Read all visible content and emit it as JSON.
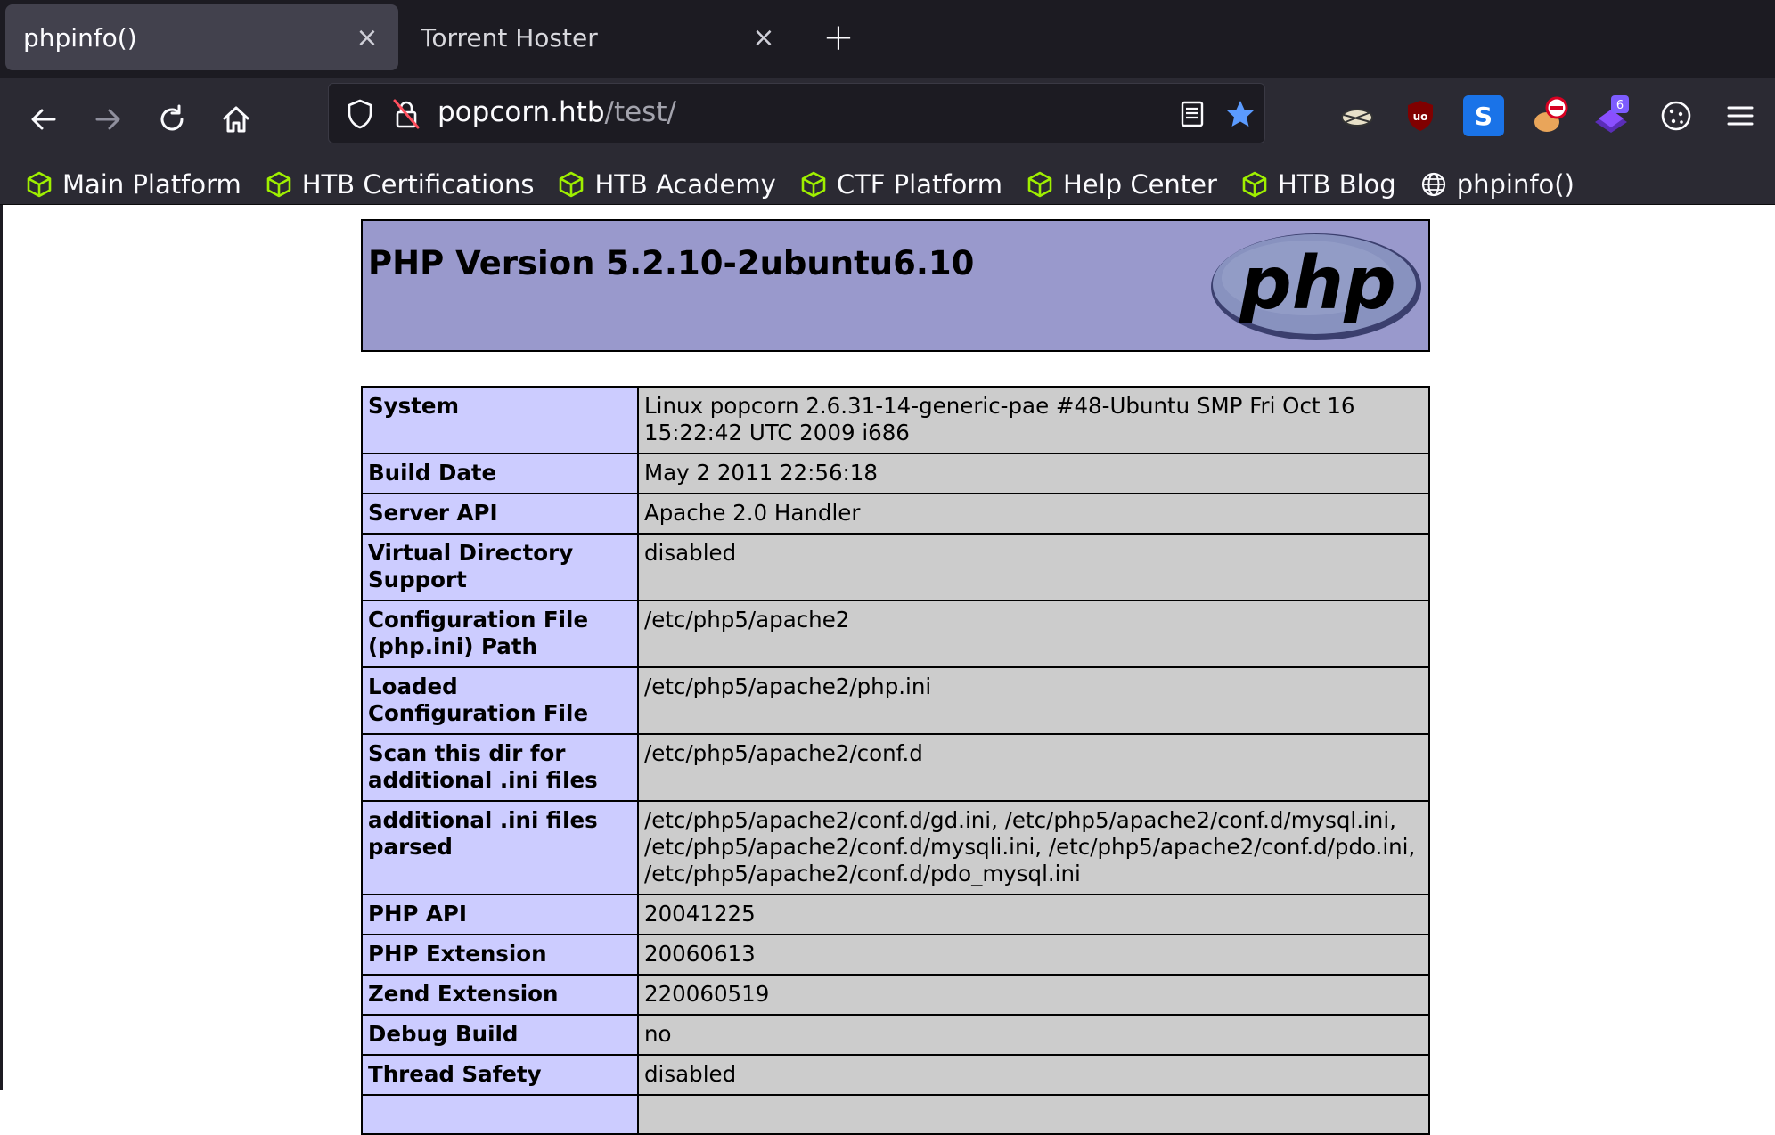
{
  "tabs": [
    {
      "title": "phpinfo()",
      "active": true
    },
    {
      "title": "Torrent Hoster",
      "active": false
    }
  ],
  "tab_close_glyph": "×",
  "new_tab_glyph": "+",
  "urlbar": {
    "host": "popcorn.htb",
    "path": "/test/"
  },
  "extensions": [
    "user-agent-switcher-icon",
    "ublock-origin-icon",
    "s-extension-icon",
    "blocker-extension-icon",
    "badge-extension-icon",
    "cookie-icon"
  ],
  "extension_badge": "6",
  "ublock_label": "uo",
  "s_label": "S",
  "bookmarks": [
    {
      "label": "Main Platform",
      "icon": "htb-cube-icon"
    },
    {
      "label": "HTB Certifications",
      "icon": "htb-cube-icon"
    },
    {
      "label": "HTB Academy",
      "icon": "htb-cube-icon"
    },
    {
      "label": "CTF Platform",
      "icon": "htb-cube-icon"
    },
    {
      "label": "Help Center",
      "icon": "htb-cube-icon"
    },
    {
      "label": "HTB Blog",
      "icon": "htb-cube-icon"
    },
    {
      "label": "phpinfo()",
      "icon": "globe-icon"
    }
  ],
  "header": {
    "title": "PHP Version 5.2.10-2ubuntu6.10",
    "logo_text": "php"
  },
  "info_rows": [
    {
      "key": "System",
      "value": "Linux popcorn 2.6.31-14-generic-pae #48-Ubuntu SMP Fri Oct 16 15:22:42 UTC 2009 i686"
    },
    {
      "key": "Build Date",
      "value": "May 2 2011 22:56:18"
    },
    {
      "key": "Server API",
      "value": "Apache 2.0 Handler"
    },
    {
      "key": "Virtual Directory Support",
      "value": "disabled"
    },
    {
      "key": "Configuration File (php.ini) Path",
      "value": "/etc/php5/apache2"
    },
    {
      "key": "Loaded Configuration File",
      "value": "/etc/php5/apache2/php.ini"
    },
    {
      "key": "Scan this dir for additional .ini files",
      "value": "/etc/php5/apache2/conf.d"
    },
    {
      "key": "additional .ini files parsed",
      "value": "/etc/php5/apache2/conf.d/gd.ini, /etc/php5/apache2/conf.d/mysql.ini, /etc/php5/apache2/conf.d/mysqli.ini, /etc/php5/apache2/conf.d/pdo.ini, /etc/php5/apache2/conf.d/pdo_mysql.ini"
    },
    {
      "key": "PHP API",
      "value": "20041225"
    },
    {
      "key": "PHP Extension",
      "value": "20060613"
    },
    {
      "key": "Zend Extension",
      "value": "220060519"
    },
    {
      "key": "Debug Build",
      "value": "no"
    },
    {
      "key": "Thread Safety",
      "value": "disabled"
    },
    {
      "key": "",
      "value": ""
    }
  ],
  "colors": {
    "header_bg": "#9999cc",
    "key_bg": "#ccccff",
    "value_bg": "#cccccc",
    "chrome_dark": "#1c1b22",
    "chrome_toolbar": "#2b2a33",
    "htb_green": "#9fef00",
    "star_blue": "#5b9bff"
  }
}
